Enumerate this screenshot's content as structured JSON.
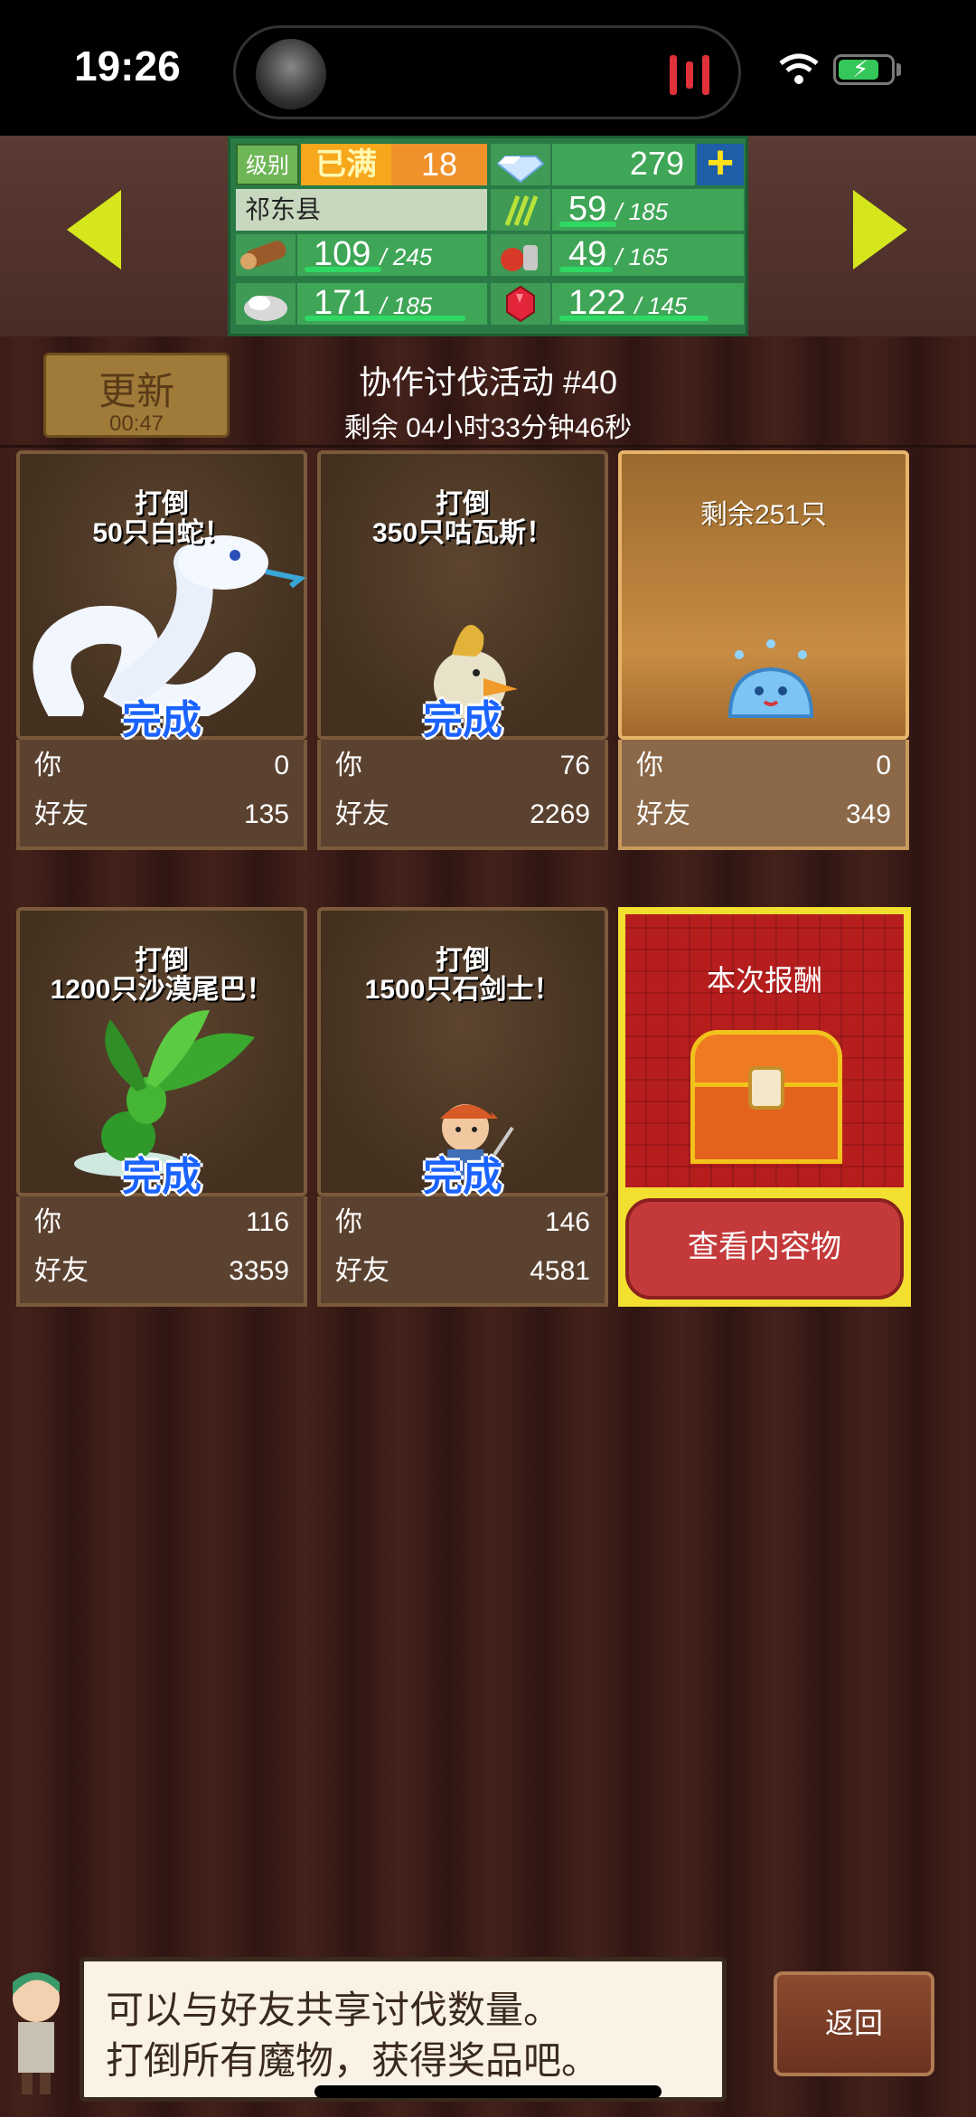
{
  "status_bar": {
    "time": "19:26"
  },
  "resources": {
    "level_label": "级别",
    "level_status": "已满",
    "level": "18",
    "gems": "279",
    "town": "祁东县",
    "wood": {
      "value": "109",
      "max": "/ 245",
      "fill": 0.44
    },
    "stone": {
      "value": "171",
      "max": "/ 185",
      "fill": 0.92
    },
    "grass": {
      "value": "59",
      "max": "/ 185",
      "fill": 0.32
    },
    "food": {
      "value": "49",
      "max": "/ 165",
      "fill": 0.3
    },
    "ruby": {
      "value": "122",
      "max": "/ 145",
      "fill": 0.84
    }
  },
  "header": {
    "refresh_label": "更新",
    "refresh_timer": "00:47",
    "title": "协作讨伐活动 #40",
    "remaining": "剩余 04小时33分钟46秒"
  },
  "labels": {
    "you": "你",
    "friends": "好友",
    "done": "完成"
  },
  "cards": [
    {
      "line1": "打倒",
      "line2": "50只白蛇！",
      "you": "0",
      "friends": "135",
      "done": true
    },
    {
      "line1": "打倒",
      "line2": "350只咕瓦斯！",
      "you": "76",
      "friends": "2269",
      "done": true
    },
    {
      "line1": "剩余251只",
      "line2": "",
      "you": "0",
      "friends": "349",
      "done": false
    },
    {
      "line1": "打倒",
      "line2": "1200只沙漠尾巴！",
      "you": "116",
      "friends": "3359",
      "done": true
    },
    {
      "line1": "打倒",
      "line2": "1500只石剑士！",
      "you": "146",
      "friends": "4581",
      "done": true
    }
  ],
  "reward": {
    "title": "本次报酬",
    "button": "查看内容物"
  },
  "dialog": {
    "line1": "可以与好友共享讨伐数量。",
    "line2": "打倒所有魔物，获得奖品吧。"
  },
  "back_button": "返回",
  "colors": {
    "done_blue": "#1a63ff",
    "accent_yellow": "#d6e61d",
    "panel_green": "#2a7a46"
  }
}
